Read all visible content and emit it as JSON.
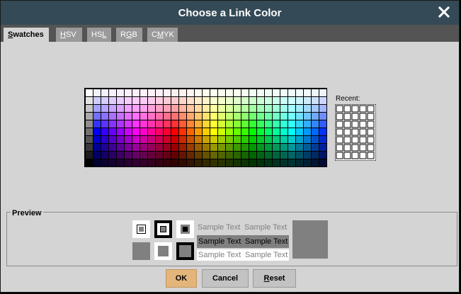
{
  "window": {
    "title": "Choose a Link Color",
    "close_icon": "close-icon"
  },
  "tabs": [
    {
      "pre": "",
      "mnemonic": "S",
      "post": "watches",
      "active": true
    },
    {
      "pre": "",
      "mnemonic": "H",
      "post": "SV",
      "active": false
    },
    {
      "pre": "HS",
      "mnemonic": "L",
      "post": "",
      "active": false
    },
    {
      "pre": "R",
      "mnemonic": "G",
      "post": "B",
      "active": false
    },
    {
      "pre": "C",
      "mnemonic": "M",
      "post": "YK",
      "active": false
    }
  ],
  "swatches": {
    "columns": 31,
    "rows": 10
  },
  "recent": {
    "label": "Recent:",
    "columns": 5,
    "rows": 7
  },
  "preview": {
    "legend": "Preview",
    "sample_text": "Sample Text",
    "selected_color": "#808080"
  },
  "buttons": {
    "ok": {
      "label": "OK"
    },
    "cancel": {
      "label": "Cancel"
    },
    "reset": {
      "pre": "",
      "mnemonic": "R",
      "post": "eset"
    }
  }
}
